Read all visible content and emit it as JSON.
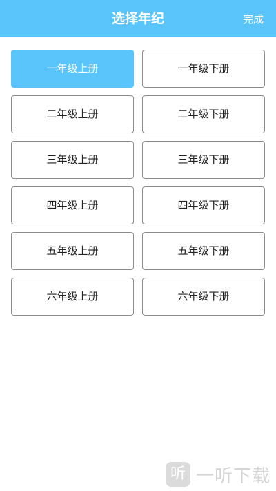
{
  "header": {
    "title": "选择年纪",
    "done_label": "完成"
  },
  "grades": [
    {
      "upper": "一年级上册",
      "lower": "一年级下册"
    },
    {
      "upper": "二年级上册",
      "lower": "二年级下册"
    },
    {
      "upper": "三年级上册",
      "lower": "三年级下册"
    },
    {
      "upper": "四年级上册",
      "lower": "四年级下册"
    },
    {
      "upper": "五年级上册",
      "lower": "五年级下册"
    },
    {
      "upper": "六年级上册",
      "lower": "六年级下册"
    }
  ],
  "selected": "一年级上册",
  "colors": {
    "accent": "#5ac5fa",
    "border": "#8c8c8c"
  },
  "watermark": {
    "icon_glyph": "听",
    "text": "一听下载"
  }
}
